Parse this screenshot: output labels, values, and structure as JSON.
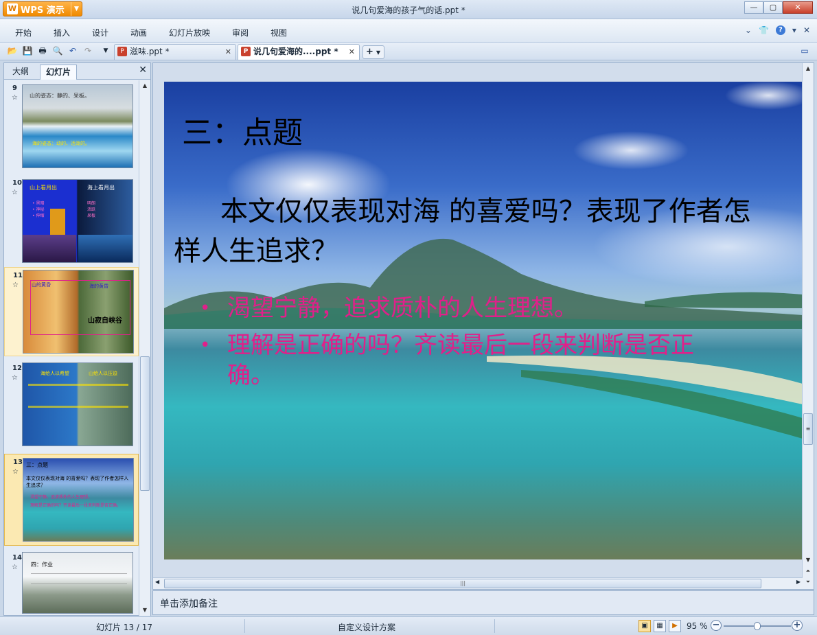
{
  "app": {
    "name": "WPS 演示",
    "document_title": "说几句爱海的孩子气的话.ppt *"
  },
  "menu": [
    "开始",
    "插入",
    "设计",
    "动画",
    "幻灯片放映",
    "审阅",
    "视图"
  ],
  "tabs": [
    {
      "label": "滋味.ppt *"
    },
    {
      "label": "说几句爱海的....ppt *",
      "active": true
    }
  ],
  "left_panel": {
    "tabs": [
      "大纲",
      "幻灯片"
    ],
    "active_tab": "幻灯片",
    "thumbnails": [
      {
        "number": "9",
        "texts": [
          "山的姿态：静的、呆板。",
          "海的姿态：动的、活泼的。"
        ]
      },
      {
        "number": "10",
        "texts": [
          "山上看月出",
          "海上看月出",
          "黑暗",
          "神秘",
          "呆板",
          "明朗",
          "活跃",
          "伸缩"
        ]
      },
      {
        "number": "11",
        "texts": [
          "山的黄昏",
          "海的黄昏",
          "山寂自峡谷"
        ]
      },
      {
        "number": "12",
        "texts": [
          "海给人以希望",
          "山给人以压迫"
        ]
      },
      {
        "number": "13",
        "texts": [
          "三：点题",
          "本文仅仅表现对海 的喜爱吗？表现了作者怎样人生追求？"
        ],
        "selected": true
      },
      {
        "number": "14",
        "texts": [
          "四：作业"
        ]
      }
    ]
  },
  "slide": {
    "title": "三：点题",
    "question": "本文仅仅表现对海 的喜爱吗？表现了作者怎样人生追求？",
    "bullets": [
      "渴望宁静，追求质朴的人生理想。",
      "理解是正确的吗？齐读最后一段来判断是否正确。"
    ],
    "bullet_color": "#e0208a"
  },
  "notes_placeholder": "单击添加备注",
  "status": {
    "slide_counter": "幻灯片 13 / 17",
    "design_scheme": "自定义设计方案",
    "zoom": "95 %",
    "zoom_level": 0.5
  }
}
